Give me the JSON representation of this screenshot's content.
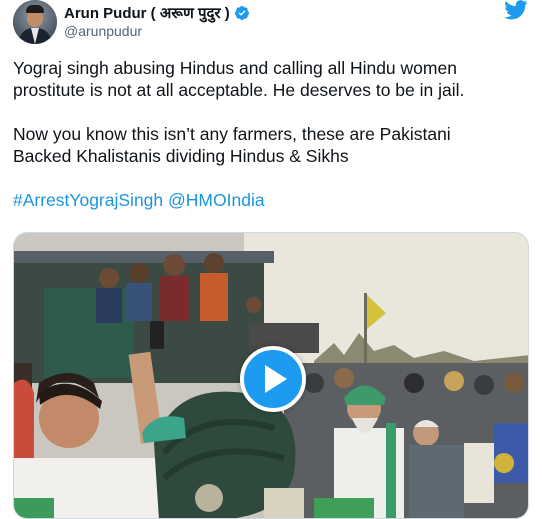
{
  "author": {
    "display_name": "Arun Pudur ( अरूण पुदुर )",
    "handle": "@arunpudur",
    "verified_icon": "verified-badge-icon",
    "avatar_icon": "profile-avatar"
  },
  "brand": {
    "icon": "twitter-bird-icon",
    "color": "#1d9bf0"
  },
  "tweet": {
    "line1": "Yograj singh abusing Hindus and calling all Hindu women",
    "line2": "prostitute is not at all acceptable. He deserves to be in jail.",
    "line3": "Now you know this isn’t any farmers, these are Pakistani",
    "line4": "Backed Khalistanis dividing Hindus & Sikhs",
    "hashtag": "#ArrestYograjSingh",
    "mention": "@HMOIndia"
  },
  "media": {
    "type": "video",
    "play_icon": "play-icon"
  },
  "colors": {
    "text": "#0f1419",
    "secondary": "#536471",
    "link": "#1b95e0",
    "accent": "#1d9bf0"
  }
}
